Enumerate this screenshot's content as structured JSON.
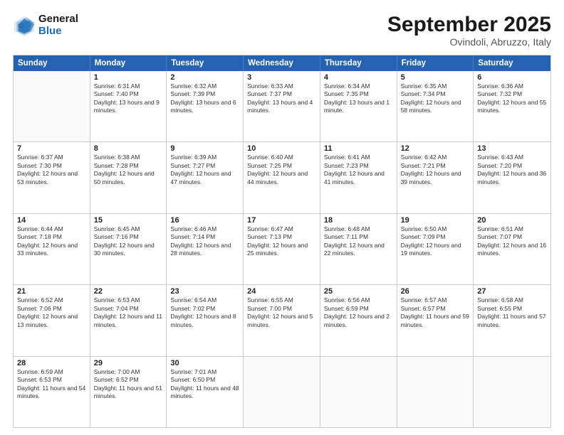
{
  "header": {
    "logo_general": "General",
    "logo_blue": "Blue",
    "month": "September 2025",
    "location": "Ovindoli, Abruzzo, Italy"
  },
  "days_of_week": [
    "Sunday",
    "Monday",
    "Tuesday",
    "Wednesday",
    "Thursday",
    "Friday",
    "Saturday"
  ],
  "weeks": [
    [
      {
        "day": "",
        "empty": true
      },
      {
        "day": "1",
        "sunrise": "6:31 AM",
        "sunset": "7:40 PM",
        "daylight": "13 hours and 9 minutes."
      },
      {
        "day": "2",
        "sunrise": "6:32 AM",
        "sunset": "7:39 PM",
        "daylight": "13 hours and 6 minutes."
      },
      {
        "day": "3",
        "sunrise": "6:33 AM",
        "sunset": "7:37 PM",
        "daylight": "13 hours and 4 minutes."
      },
      {
        "day": "4",
        "sunrise": "6:34 AM",
        "sunset": "7:35 PM",
        "daylight": "13 hours and 1 minute."
      },
      {
        "day": "5",
        "sunrise": "6:35 AM",
        "sunset": "7:34 PM",
        "daylight": "12 hours and 58 minutes."
      },
      {
        "day": "6",
        "sunrise": "6:36 AM",
        "sunset": "7:32 PM",
        "daylight": "12 hours and 55 minutes."
      }
    ],
    [
      {
        "day": "7",
        "sunrise": "6:37 AM",
        "sunset": "7:30 PM",
        "daylight": "12 hours and 53 minutes."
      },
      {
        "day": "8",
        "sunrise": "6:38 AM",
        "sunset": "7:28 PM",
        "daylight": "12 hours and 50 minutes."
      },
      {
        "day": "9",
        "sunrise": "6:39 AM",
        "sunset": "7:27 PM",
        "daylight": "12 hours and 47 minutes."
      },
      {
        "day": "10",
        "sunrise": "6:40 AM",
        "sunset": "7:25 PM",
        "daylight": "12 hours and 44 minutes."
      },
      {
        "day": "11",
        "sunrise": "6:41 AM",
        "sunset": "7:23 PM",
        "daylight": "12 hours and 41 minutes."
      },
      {
        "day": "12",
        "sunrise": "6:42 AM",
        "sunset": "7:21 PM",
        "daylight": "12 hours and 39 minutes."
      },
      {
        "day": "13",
        "sunrise": "6:43 AM",
        "sunset": "7:20 PM",
        "daylight": "12 hours and 36 minutes."
      }
    ],
    [
      {
        "day": "14",
        "sunrise": "6:44 AM",
        "sunset": "7:18 PM",
        "daylight": "12 hours and 33 minutes."
      },
      {
        "day": "15",
        "sunrise": "6:45 AM",
        "sunset": "7:16 PM",
        "daylight": "12 hours and 30 minutes."
      },
      {
        "day": "16",
        "sunrise": "6:46 AM",
        "sunset": "7:14 PM",
        "daylight": "12 hours and 28 minutes."
      },
      {
        "day": "17",
        "sunrise": "6:47 AM",
        "sunset": "7:13 PM",
        "daylight": "12 hours and 25 minutes."
      },
      {
        "day": "18",
        "sunrise": "6:48 AM",
        "sunset": "7:11 PM",
        "daylight": "12 hours and 22 minutes."
      },
      {
        "day": "19",
        "sunrise": "6:50 AM",
        "sunset": "7:09 PM",
        "daylight": "12 hours and 19 minutes."
      },
      {
        "day": "20",
        "sunrise": "6:51 AM",
        "sunset": "7:07 PM",
        "daylight": "12 hours and 16 minutes."
      }
    ],
    [
      {
        "day": "21",
        "sunrise": "6:52 AM",
        "sunset": "7:06 PM",
        "daylight": "12 hours and 13 minutes."
      },
      {
        "day": "22",
        "sunrise": "6:53 AM",
        "sunset": "7:04 PM",
        "daylight": "12 hours and 11 minutes."
      },
      {
        "day": "23",
        "sunrise": "6:54 AM",
        "sunset": "7:02 PM",
        "daylight": "12 hours and 8 minutes."
      },
      {
        "day": "24",
        "sunrise": "6:55 AM",
        "sunset": "7:00 PM",
        "daylight": "12 hours and 5 minutes."
      },
      {
        "day": "25",
        "sunrise": "6:56 AM",
        "sunset": "6:59 PM",
        "daylight": "12 hours and 2 minutes."
      },
      {
        "day": "26",
        "sunrise": "6:57 AM",
        "sunset": "6:57 PM",
        "daylight": "11 hours and 59 minutes."
      },
      {
        "day": "27",
        "sunrise": "6:58 AM",
        "sunset": "6:55 PM",
        "daylight": "11 hours and 57 minutes."
      }
    ],
    [
      {
        "day": "28",
        "sunrise": "6:59 AM",
        "sunset": "6:53 PM",
        "daylight": "11 hours and 54 minutes."
      },
      {
        "day": "29",
        "sunrise": "7:00 AM",
        "sunset": "6:52 PM",
        "daylight": "11 hours and 51 minutes."
      },
      {
        "day": "30",
        "sunrise": "7:01 AM",
        "sunset": "6:50 PM",
        "daylight": "11 hours and 48 minutes."
      },
      {
        "day": "",
        "empty": true
      },
      {
        "day": "",
        "empty": true
      },
      {
        "day": "",
        "empty": true
      },
      {
        "day": "",
        "empty": true
      }
    ]
  ],
  "labels": {
    "sunrise_prefix": "Sunrise: ",
    "sunset_prefix": "Sunset: ",
    "daylight_prefix": "Daylight: "
  }
}
